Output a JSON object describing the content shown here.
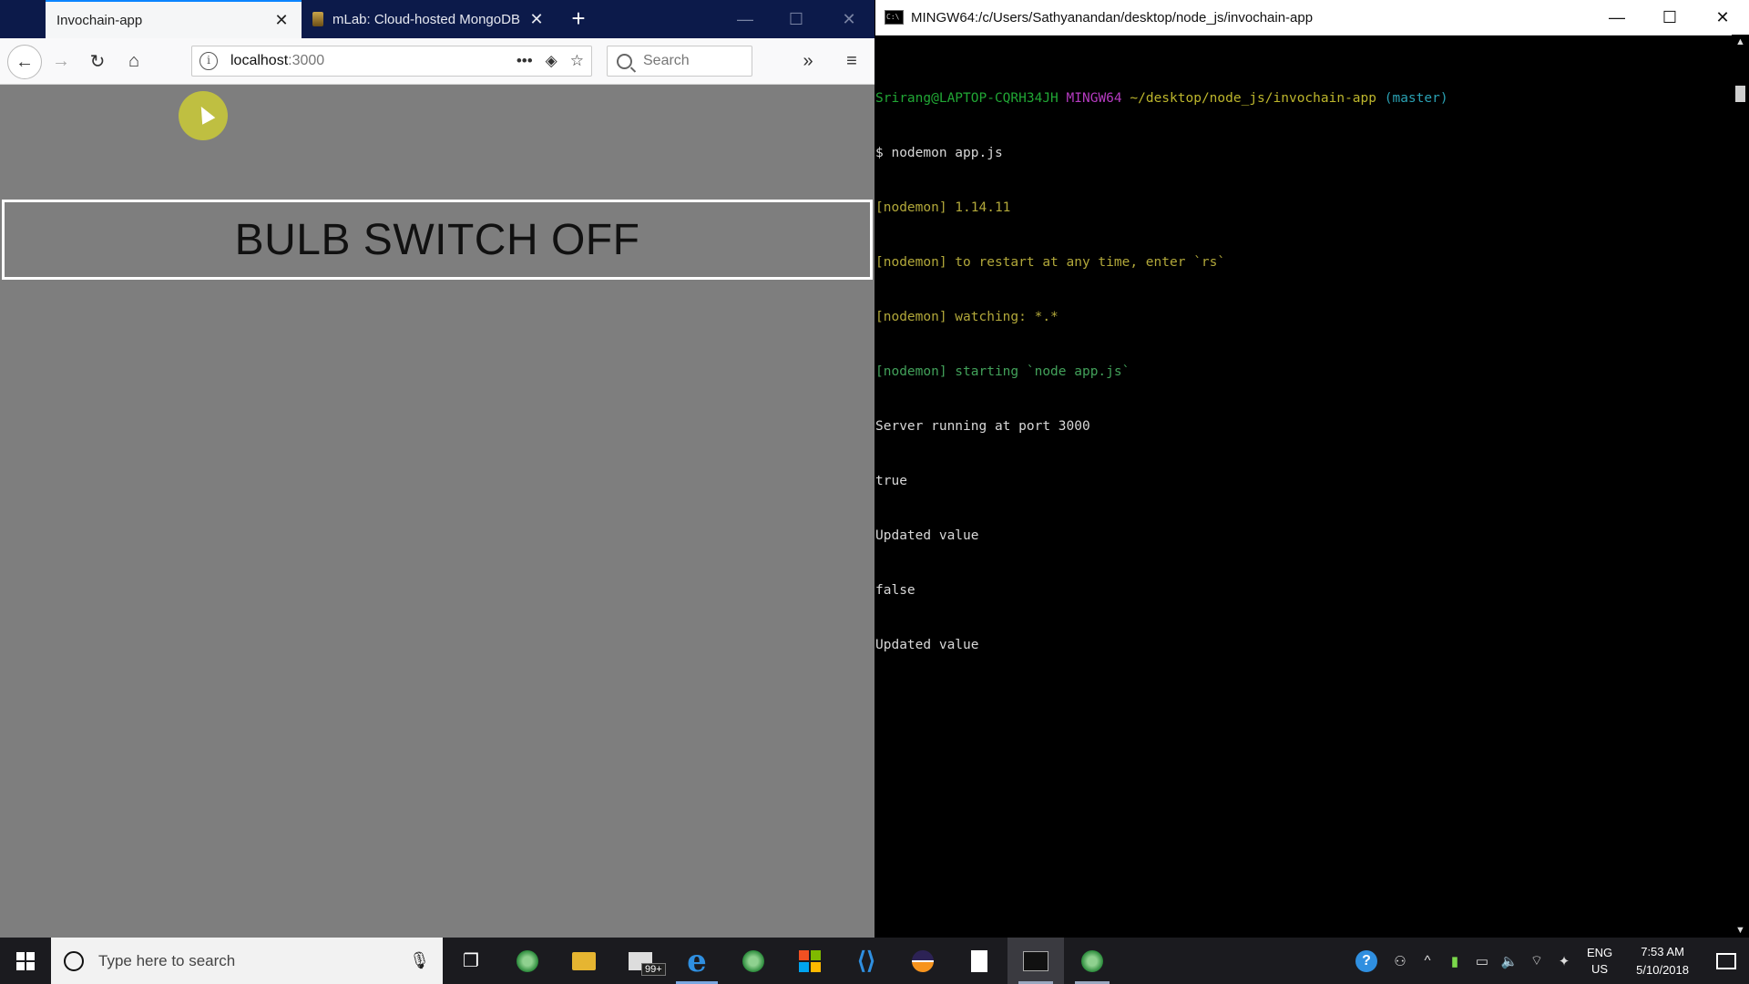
{
  "browser": {
    "tabs": [
      {
        "label": "Invochain-app",
        "active": true
      },
      {
        "label": "mLab: Cloud-hosted MongoDB",
        "active": false
      }
    ],
    "url": {
      "host": "localhost",
      "port": ":3000"
    },
    "search_placeholder": "Search",
    "page": {
      "bulb_button_label": "BULB SWITCH OFF"
    }
  },
  "terminal": {
    "title": "MINGW64:/c/Users/Sathyanandan/desktop/node_js/invochain-app",
    "prompt": {
      "user_host": "Srirang@LAPTOP-CQRH34JH",
      "shell": "MINGW64",
      "path": "~/desktop/node_js/invochain-app",
      "branch": "(master)"
    },
    "command": "$ nodemon app.js",
    "nodemon_lines": [
      "[nodemon] 1.14.11",
      "[nodemon] to restart at any time, enter `rs`",
      "[nodemon] watching: *.*",
      "[nodemon] starting `node app.js`"
    ],
    "output_lines": [
      "Server running at port 3000",
      "true",
      "Updated value",
      "false",
      "Updated value"
    ]
  },
  "taskbar": {
    "search_placeholder": "Type here to search",
    "mail_badge": "99+",
    "language": {
      "line1": "ENG",
      "line2": "US"
    },
    "clock": {
      "time": "7:53 AM",
      "date": "5/10/2018"
    }
  },
  "colors": {
    "browser_tabstrip": "#0c1a4a",
    "page_background": "#7e7e7e",
    "terminal_background": "#000000",
    "prompt_green": "#21a735",
    "prompt_magenta": "#b53bc0",
    "prompt_yellow": "#bdb62c",
    "prompt_cyan": "#2aa1b3"
  }
}
